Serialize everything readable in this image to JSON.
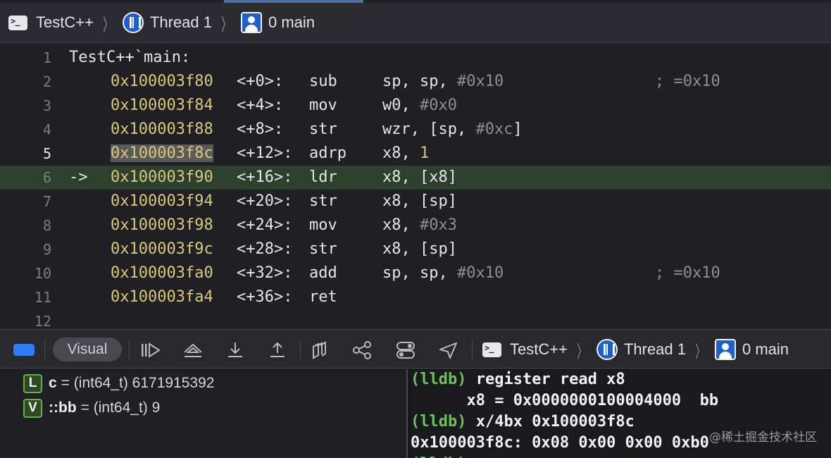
{
  "jump_bar": {
    "project": "TestC++",
    "thread": "Thread 1",
    "frame": "0 main",
    "icons": [
      "terminal-icon",
      "thread-icon",
      "stack-frame-icon"
    ]
  },
  "disassembly": {
    "header": "TestC++`main:",
    "current_arrow": "->",
    "line_numbers": [
      "1",
      "2",
      "3",
      "4",
      "5",
      "6",
      "7",
      "8",
      "9",
      "10",
      "11",
      "12"
    ],
    "instructions": [
      {
        "addr": "0x100003f80",
        "off": "<+0>:",
        "op": "sub",
        "args_a": "sp, sp, ",
        "args_b": "#0x10",
        "args_c": "]",
        "comment": "; =0x10"
      },
      {
        "addr": "0x100003f84",
        "off": "<+4>:",
        "op": "mov",
        "args_a": "w0, ",
        "args_b": "#0x0",
        "args_c": "",
        "comment": ""
      },
      {
        "addr": "0x100003f88",
        "off": "<+8>:",
        "op": "str",
        "args_a": "wzr, [sp, ",
        "args_b": "#0xc",
        "args_c": "]",
        "comment": ""
      },
      {
        "addr": "0x100003f8c",
        "off": "<+12>:",
        "op": "adrp",
        "args_a": "x8, ",
        "args_b": "1",
        "args_c": "",
        "comment": ""
      },
      {
        "addr": "0x100003f90",
        "off": "<+16>:",
        "op": "ldr",
        "args_a": "x8, [x8]",
        "args_b": "",
        "args_c": "",
        "comment": ""
      },
      {
        "addr": "0x100003f94",
        "off": "<+20>:",
        "op": "str",
        "args_a": "x8, [sp]",
        "args_b": "",
        "args_c": "",
        "comment": ""
      },
      {
        "addr": "0x100003f98",
        "off": "<+24>:",
        "op": "mov",
        "args_a": "x8, ",
        "args_b": "#0x3",
        "args_c": "",
        "comment": ""
      },
      {
        "addr": "0x100003f9c",
        "off": "<+28>:",
        "op": "str",
        "args_a": "x8, [sp]",
        "args_b": "",
        "args_c": "",
        "comment": ""
      },
      {
        "addr": "0x100003fa0",
        "off": "<+32>:",
        "op": "add",
        "args_a": "sp, sp, ",
        "args_b": "#0x10",
        "args_c": "",
        "comment": "; =0x10"
      },
      {
        "addr": "0x100003fa4",
        "off": "<+36>:",
        "op": "ret",
        "args_a": "",
        "args_b": "",
        "args_c": "",
        "comment": ""
      }
    ]
  },
  "debug_bar": {
    "visual_label": "Visual",
    "project": "TestC++",
    "thread": "Thread 1",
    "frame": "0 main",
    "tools": [
      "continue-icon",
      "step-over-icon",
      "step-into-icon",
      "step-out-icon",
      "view-hierarchy-icon",
      "memory-graph-icon",
      "environment-overrides-icon",
      "location-icon"
    ]
  },
  "variables": [
    {
      "kind": "L",
      "name": "c",
      "value": "= (int64_t) 6171915392"
    },
    {
      "kind": "V",
      "name": "::bb",
      "value": "= (int64_t) 9"
    }
  ],
  "console": {
    "prompt": "(lldb)",
    "cmd1": " register read x8",
    "out1": "      x8 = 0x0000000100004000  bb",
    "cmd2": " x/4bx 0x100003f8c",
    "out2": "0x100003f8c: 0x08 0x00 0x00 0xb0"
  },
  "watermark": "@稀土掘金技术社区",
  "colors": {
    "address": "#d9c97c",
    "current_line": "#2d3f2d",
    "prompt": "#6cc15a",
    "accent": "#2f7cf6"
  }
}
